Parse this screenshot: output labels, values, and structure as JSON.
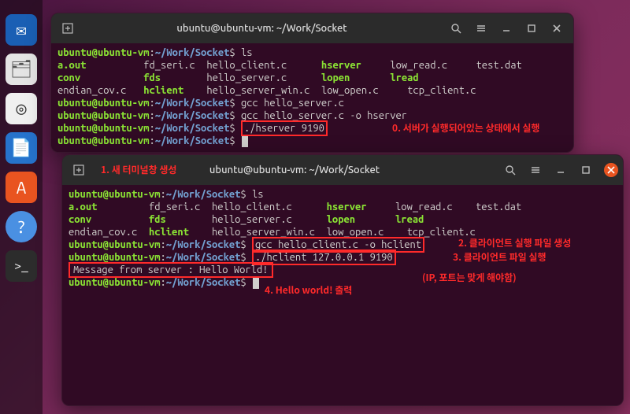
{
  "dock": {
    "items": [
      {
        "name": "thunderbird",
        "glyph": "✉"
      },
      {
        "name": "files",
        "glyph": "🗂"
      },
      {
        "name": "rhythmbox",
        "glyph": "◎"
      },
      {
        "name": "writer",
        "glyph": "📄"
      },
      {
        "name": "software",
        "glyph": "A"
      },
      {
        "name": "help",
        "glyph": "?"
      },
      {
        "name": "terminal",
        "glyph": ">_"
      }
    ]
  },
  "window1": {
    "title": "ubuntu@ubuntu-vm: ~/Work/Socket",
    "prompt_user": "ubuntu@ubuntu-vm",
    "prompt_path": "~/Work/Socket",
    "cmd_ls": "ls",
    "ls": {
      "r1c1": "a.out",
      "r1c2": "fd_seri.c",
      "r1c3": "hello_client.c",
      "r1c4": "hserver",
      "r1c5": "low_read.c",
      "r1c6": "test.dat",
      "r2c1": "conv",
      "r2c2": "fds",
      "r2c3": "hello_server.c",
      "r2c4": "lopen",
      "r2c5": "lread",
      "r3c1": "endian_cov.c",
      "r3c2": "hclient",
      "r3c3": "hello_server_win.c",
      "r3c4": "low_open.c",
      "r3c5": "tcp_client.c"
    },
    "cmd_gcc1": "gcc hello_server.c",
    "cmd_gcc2": "gcc hello_server.c -o hserver",
    "cmd_run": "./hserver 9190"
  },
  "window2": {
    "title": "ubuntu@ubuntu-vm: ~/Work/Socket",
    "prompt_user": "ubuntu@ubuntu-vm",
    "prompt_path": "~/Work/Socket",
    "cmd_ls": "ls",
    "ls": {
      "r1c1": "a.out",
      "r1c2": "fd_seri.c",
      "r1c3": "hello_client.c",
      "r1c4": "hserver",
      "r1c5": "low_read.c",
      "r1c6": "test.dat",
      "r2c1": "conv",
      "r2c2": "fds",
      "r2c3": "hello_server.c",
      "r2c4": "lopen",
      "r2c5": "lread",
      "r3c1": "endian_cov.c",
      "r3c2": "hclient",
      "r3c3": "hello_server_win.c",
      "r3c4": "low_open.c",
      "r3c5": "tcp_client.c"
    },
    "cmd_gcc": "gcc hello_client.c -o hclient",
    "cmd_run": "./hclient 127.0.0.1 9190",
    "output": "Message from server : Hello World!"
  },
  "annotations": {
    "a0": "0. 서버가 실행되어있는 상태에서 실행",
    "a1": "1. 새 터미널창 생성",
    "a2": "2. 클라이언트 실행 파일 생성",
    "a3": "3. 클라이언트 파일 실행",
    "a3b": "(IP, 포트는 맞게 해야함)",
    "a4": "4. Hello world! 출력"
  }
}
